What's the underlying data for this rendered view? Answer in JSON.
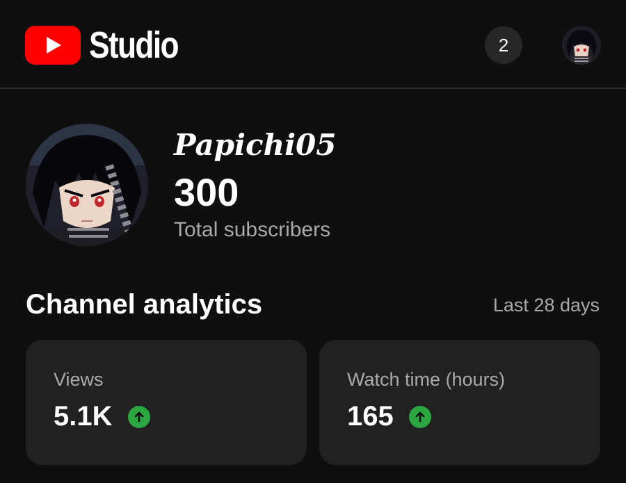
{
  "header": {
    "logo_text": "Studio",
    "notification_count": "2",
    "brand_color": "#ff0000"
  },
  "channel": {
    "name": "Papichi05",
    "subscriber_count": "300",
    "subscriber_label": "Total subscribers"
  },
  "analytics": {
    "title": "Channel analytics",
    "period": "Last 28 days",
    "cards": [
      {
        "label": "Views",
        "value": "5.1K",
        "trend": "up",
        "trend_icon": "arrow-up-icon"
      },
      {
        "label": "Watch time (hours)",
        "value": "165",
        "trend": "up",
        "trend_icon": "arrow-up-icon"
      }
    ],
    "trend_color": "#2ba640"
  }
}
